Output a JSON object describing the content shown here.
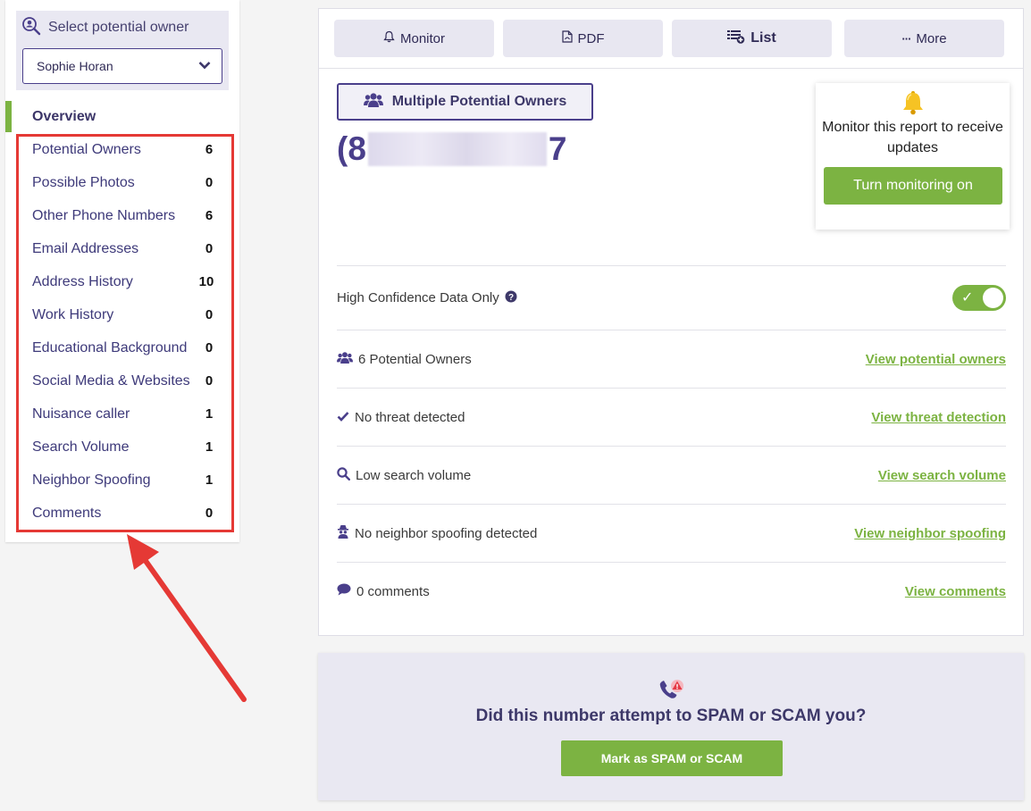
{
  "sidebar": {
    "owner_select_label": "Select potential owner",
    "selected_owner": "Sophie Horan",
    "overview_label": "Overview",
    "items": [
      {
        "label": "Potential Owners",
        "count": "6"
      },
      {
        "label": "Possible Photos",
        "count": "0"
      },
      {
        "label": "Other Phone Numbers",
        "count": "6"
      },
      {
        "label": "Email Addresses",
        "count": "0"
      },
      {
        "label": "Address History",
        "count": "10"
      },
      {
        "label": "Work History",
        "count": "0"
      },
      {
        "label": "Educational Background",
        "count": "0"
      },
      {
        "label": "Social Media & Websites",
        "count": "0"
      },
      {
        "label": "Nuisance caller",
        "count": "1"
      },
      {
        "label": "Search Volume",
        "count": "1"
      },
      {
        "label": "Neighbor Spoofing",
        "count": "1"
      },
      {
        "label": "Comments",
        "count": "0"
      }
    ]
  },
  "toolbar": {
    "monitor": "Monitor",
    "pdf": "PDF",
    "list": "List",
    "more": "More"
  },
  "report": {
    "multiple_owners_label": "Multiple Potential Owners",
    "phone_prefix": "(8",
    "phone_suffix": "7"
  },
  "monitor_card": {
    "message": "Monitor this report to receive updates",
    "button": "Turn monitoring on"
  },
  "high_confidence": {
    "label": "High Confidence Data Only",
    "enabled": true
  },
  "summary_rows": [
    {
      "icon": "users-icon",
      "text": "6 Potential Owners",
      "link": "View potential owners"
    },
    {
      "icon": "check-icon",
      "text": "No threat detected",
      "link": "View threat detection"
    },
    {
      "icon": "search-icon",
      "text": "Low search volume",
      "link": "View search volume"
    },
    {
      "icon": "spy-icon",
      "text": "No neighbor spoofing detected",
      "link": "View neighbor spoofing"
    },
    {
      "icon": "comment-icon",
      "text": "0 comments",
      "link": "View comments"
    }
  ],
  "spam_panel": {
    "question": "Did this number attempt to SPAM or SCAM you?",
    "button": "Mark as SPAM or SCAM"
  },
  "colors": {
    "accent_green": "#7cb342",
    "brand_purple": "#4a3f8b",
    "highlight_red": "#e53935"
  }
}
